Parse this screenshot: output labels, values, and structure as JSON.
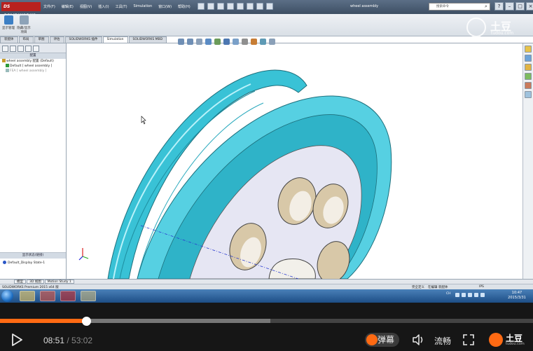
{
  "solidworks": {
    "logo": "DS SOLIDWORKS",
    "menu": [
      "文件(F)",
      "编辑(E)",
      "视图(V)",
      "插入(I)",
      "工具(T)",
      "Simulation",
      "窗口(W)",
      "帮助(H)"
    ],
    "doc_title": "wheel assembly",
    "search_placeholder": "搜索命令",
    "window_buttons": [
      "?",
      "–",
      "□",
      "×"
    ],
    "ribbon": [
      {
        "label": "显示管理",
        "color": "#3c7fc4"
      },
      {
        "label": "隐藏/显示 项目",
        "color": "#8da3b8"
      }
    ],
    "tabs": [
      {
        "label": "装配体",
        "active": false
      },
      {
        "label": "布局",
        "active": false
      },
      {
        "label": "草图",
        "active": false
      },
      {
        "label": "评估",
        "active": false
      },
      {
        "label": "SOLIDWORKS 插件",
        "active": false
      },
      {
        "label": "Simulation",
        "active": true
      },
      {
        "label": "SOLIDWORKS MBD",
        "active": false
      }
    ],
    "panel": {
      "header": "配置",
      "tree": [
        "wheel assembly 配置 (Default)",
        "Default [ wheel assembly ]",
        "FEA [ wheel assembly ]"
      ],
      "display_header": "显示状态(链接)",
      "display_item": "Default_Display State-1"
    },
    "model_tabs": [
      "模型",
      "3D 视图",
      "Motion Study 1"
    ],
    "status": {
      "left": "SOLIDWORKS Premium 2015 x64 版",
      "mid": [
        "完全定义",
        "在编辑 装配体"
      ],
      "units": "IPS"
    }
  },
  "taskbar": {
    "lang": "CH",
    "time": "10:47",
    "date": "2015/3/31"
  },
  "watermark": {
    "text": "土豆",
    "sub": "tudou.com"
  },
  "player": {
    "current_time": "08:51",
    "separator": " / ",
    "total_time": "53:02",
    "played_fraction": 0.162,
    "buffered_fraction": 0.507,
    "danmu_label": "弹幕",
    "quality_label": "流畅",
    "brand_text": "土豆",
    "brand_sub": "tudou.com",
    "accent": "#ff6a13"
  }
}
